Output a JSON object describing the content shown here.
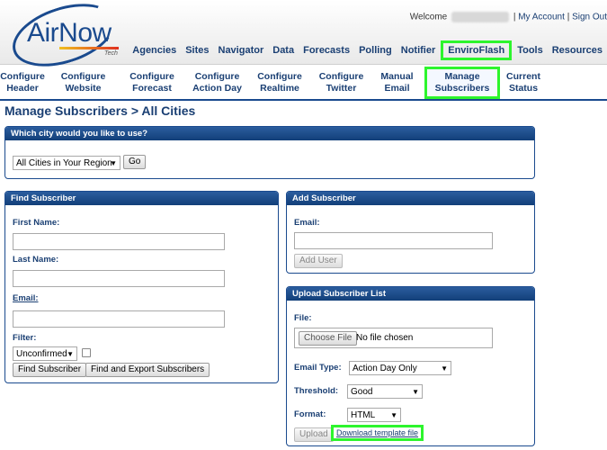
{
  "brand": {
    "name": "AirNow",
    "tagline": "Tech"
  },
  "user_bar": {
    "welcome": "Welcome",
    "my_account": "My Account",
    "sign_out": "Sign Out"
  },
  "top_nav": [
    "Agencies",
    "Sites",
    "Navigator",
    "Data",
    "Forecasts",
    "Polling",
    "Notifier",
    "EnviroFlash",
    "Tools",
    "Resources"
  ],
  "top_nav_active": "EnviroFlash",
  "sub_nav": [
    {
      "l1": "Configure",
      "l2": "Header"
    },
    {
      "l1": "Configure",
      "l2": "Website"
    },
    {
      "l1": "Configure",
      "l2": "Forecast"
    },
    {
      "l1": "Configure",
      "l2": "Action Day"
    },
    {
      "l1": "Configure",
      "l2": "Realtime"
    },
    {
      "l1": "Configure",
      "l2": "Twitter"
    },
    {
      "l1": "Manual",
      "l2": "Email"
    },
    {
      "l1": "Manage",
      "l2": "Subscribers"
    },
    {
      "l1": "Current",
      "l2": "Status"
    }
  ],
  "page_title": "Manage Subscribers > All Cities",
  "city_panel": {
    "title": "Which city would you like to use?",
    "selected": "All Cities in Your Region",
    "go_label": "Go"
  },
  "find_panel": {
    "title": "Find Subscriber",
    "first_name_label": "First Name:",
    "last_name_label": "Last Name:",
    "email_label": "Email:",
    "filter_label": "Filter:",
    "filter_selected": "Unconfirmed",
    "find_label": "Find Subscriber",
    "export_label": "Find and Export Subscribers"
  },
  "add_panel": {
    "title": "Add Subscriber",
    "email_label": "Email:",
    "add_label": "Add User"
  },
  "upload_panel": {
    "title": "Upload Subscriber List",
    "file_label": "File:",
    "choose_label": "Choose File",
    "no_file": "No file chosen",
    "email_type_label": "Email Type:",
    "email_type_selected": "Action Day Only",
    "threshold_label": "Threshold:",
    "threshold_selected": "Good",
    "format_label": "Format:",
    "format_selected": "HTML",
    "upload_label": "Upload",
    "template_link": "Download template file"
  },
  "colors": {
    "brand_blue": "#1a4a8e",
    "highlight_green": "#2df52d"
  }
}
